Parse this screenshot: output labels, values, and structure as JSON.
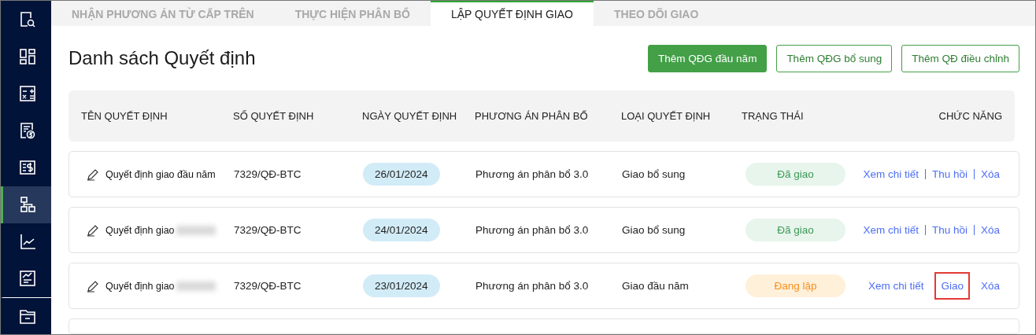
{
  "sidebar": {
    "items": [
      {
        "selected": false
      },
      {
        "selected": false
      },
      {
        "selected": false
      },
      {
        "selected": false
      },
      {
        "selected": false
      },
      {
        "selected": true
      },
      {
        "selected": false
      },
      {
        "selected": false
      },
      {
        "selected": false
      }
    ]
  },
  "tabs": [
    {
      "label": "NHẬN PHƯƠNG ÁN TỪ CẤP TRÊN",
      "selected": false
    },
    {
      "label": "THỰC HIỆN PHÂN BỔ",
      "selected": false
    },
    {
      "label": "LẬP QUYẾT ĐỊNH GIAO",
      "selected": true
    },
    {
      "label": "THEO DÕI GIAO",
      "selected": false
    }
  ],
  "page_title": "Danh sách Quyết định",
  "buttons": [
    {
      "label": "Thêm QĐG đầu năm",
      "kind": "primary"
    },
    {
      "label": "Thêm QĐG bổ sung",
      "kind": "outline"
    },
    {
      "label": "Thêm QĐ điều chỉnh",
      "kind": "outline"
    }
  ],
  "table": {
    "columns": [
      "TÊN QUYẾT ĐỊNH",
      "SỐ QUYẾT ĐỊNH",
      "NGÀY QUYẾT ĐỊNH",
      "PHƯƠNG ÁN PHÂN BỔ",
      "LOẠI QUYẾT ĐỊNH",
      "TRẠNG THÁI",
      "CHỨC NĂNG"
    ],
    "rows": [
      {
        "name": "Quyết định giao đầu năm",
        "name_blurred": false,
        "number": "7329/QĐ-BTC",
        "date": "26/01/2024",
        "plan": "Phương án phân bổ 3.0",
        "type": "Giao bổ sung",
        "status": {
          "label": "Đã giao",
          "kind": "done"
        },
        "separators": true,
        "actions": [
          {
            "label": "Xem chi tiết",
            "highlighted": false
          },
          {
            "label": "Thu hồi",
            "highlighted": false
          },
          {
            "label": "Xóa",
            "highlighted": false
          }
        ]
      },
      {
        "name": "Quyết định giao",
        "name_blurred": true,
        "number": "7329/QĐ-BTC",
        "date": "24/01/2024",
        "plan": "Phương án phân bổ 3.0",
        "type": "Giao bổ sung",
        "status": {
          "label": "Đã giao",
          "kind": "done"
        },
        "separators": true,
        "actions": [
          {
            "label": "Xem chi tiết",
            "highlighted": false
          },
          {
            "label": "Thu hồi",
            "highlighted": false
          },
          {
            "label": "Xóa",
            "highlighted": false
          }
        ]
      },
      {
        "name": "Quyết định giao",
        "name_blurred": true,
        "number": "7329/QĐ-BTC",
        "date": "23/01/2024",
        "plan": "Phương án phân bổ 3.0",
        "type": "Giao đầu năm",
        "status": {
          "label": "Đang lập",
          "kind": "draft"
        },
        "separators": false,
        "actions": [
          {
            "label": "Xem chi tiết",
            "highlighted": false
          },
          {
            "label": "Giao",
            "highlighted": true
          },
          {
            "label": "Xóa",
            "highlighted": false
          }
        ]
      }
    ]
  }
}
